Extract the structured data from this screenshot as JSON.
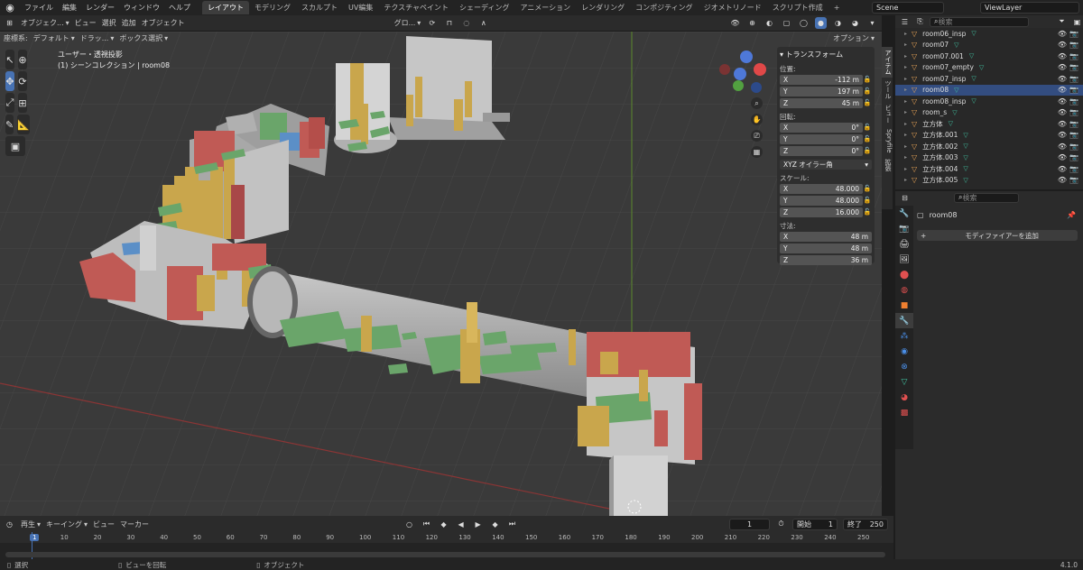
{
  "menu": [
    "ファイル",
    "編集",
    "レンダー",
    "ウィンドウ",
    "ヘルプ"
  ],
  "workspaces": [
    "レイアウト",
    "モデリング",
    "スカルプト",
    "UV編集",
    "テクスチャペイント",
    "シェーディング",
    "アニメーション",
    "レンダリング",
    "コンポジティング",
    "ジオメトリノード",
    "スクリプト作成"
  ],
  "workspace_add": "+",
  "scene": "Scene",
  "viewlayer": "ViewLayer",
  "header": {
    "mode": "オブジェク...",
    "view": "ビュー",
    "select": "選択",
    "add": "追加",
    "object": "オブジェクト",
    "orientation": "グロ...",
    "options": "オプション"
  },
  "header2": {
    "coord_label": "座標系:",
    "coord": "デフォルト",
    "drag": "ドラッ...",
    "select_box": "ボックス選択"
  },
  "viewport_info": {
    "line1": "ユーザー・透視投影",
    "line2": "(1) シーンコレクション | room08"
  },
  "npanel": {
    "title": "トランスフォーム",
    "location_label": "位置:",
    "location": [
      {
        "axis": "X",
        "value": "-112 m"
      },
      {
        "axis": "Y",
        "value": "197 m"
      },
      {
        "axis": "Z",
        "value": "45 m"
      }
    ],
    "rotation_label": "回転:",
    "rotation": [
      {
        "axis": "X",
        "value": "0°"
      },
      {
        "axis": "Y",
        "value": "0°"
      },
      {
        "axis": "Z",
        "value": "0°"
      }
    ],
    "rotation_mode": "XYZ オイラー角",
    "scale_label": "スケール:",
    "scale": [
      {
        "axis": "X",
        "value": "48.000"
      },
      {
        "axis": "Y",
        "value": "48.000"
      },
      {
        "axis": "Z",
        "value": "16.000"
      }
    ],
    "dims_label": "寸法:",
    "dims": [
      {
        "axis": "X",
        "value": "48 m"
      },
      {
        "axis": "Y",
        "value": "48 m"
      },
      {
        "axis": "Z",
        "value": "36 m"
      }
    ]
  },
  "npanel_tabs": [
    "アイテム",
    "ツール",
    "ビュー",
    "Spryfile",
    "拡張"
  ],
  "outliner": {
    "search_placeholder": "検索",
    "items": [
      "room06_insp",
      "room07",
      "room07.001",
      "room07_empty",
      "room07_insp",
      "room08",
      "room08_insp",
      "room_s",
      "立方体",
      "立方体.001",
      "立方体.002",
      "立方体.003",
      "立方体.004",
      "立方体.005"
    ]
  },
  "properties": {
    "search_placeholder": "検索",
    "object_name": "room08",
    "add_modifier": "モディファイアーを追加"
  },
  "timeline": {
    "playback": "再生",
    "keying": "キーイング",
    "view": "ビュー",
    "marker": "マーカー",
    "current_frame": "1",
    "start_label": "開始",
    "start": "1",
    "end_label": "終了",
    "end": "250",
    "ticks": [
      "1",
      "10",
      "20",
      "30",
      "40",
      "50",
      "60",
      "70",
      "80",
      "90",
      "100",
      "110",
      "120",
      "130",
      "140",
      "150",
      "160",
      "170",
      "180",
      "190",
      "200",
      "210",
      "220",
      "230",
      "240",
      "250"
    ]
  },
  "status": {
    "select": "選択",
    "rotate": "ビューを回転",
    "object": "オブジェクト",
    "version": "4.1.0"
  }
}
